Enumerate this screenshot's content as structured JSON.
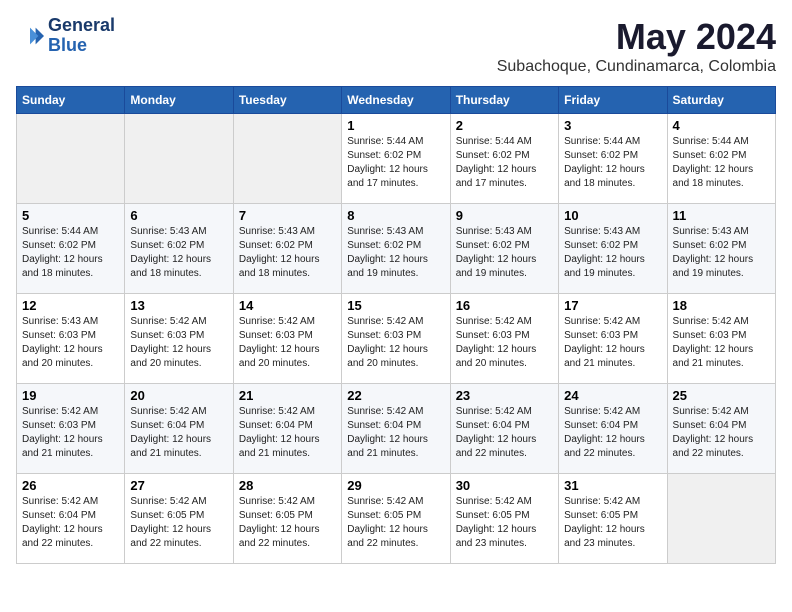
{
  "logo": {
    "line1": "General",
    "line2": "Blue"
  },
  "title": "May 2024",
  "subtitle": "Subachoque, Cundinamarca, Colombia",
  "days_of_week": [
    "Sunday",
    "Monday",
    "Tuesday",
    "Wednesday",
    "Thursday",
    "Friday",
    "Saturday"
  ],
  "weeks": [
    [
      {
        "day": "",
        "info": ""
      },
      {
        "day": "",
        "info": ""
      },
      {
        "day": "",
        "info": ""
      },
      {
        "day": "1",
        "info": "Sunrise: 5:44 AM\nSunset: 6:02 PM\nDaylight: 12 hours\nand 17 minutes."
      },
      {
        "day": "2",
        "info": "Sunrise: 5:44 AM\nSunset: 6:02 PM\nDaylight: 12 hours\nand 17 minutes."
      },
      {
        "day": "3",
        "info": "Sunrise: 5:44 AM\nSunset: 6:02 PM\nDaylight: 12 hours\nand 18 minutes."
      },
      {
        "day": "4",
        "info": "Sunrise: 5:44 AM\nSunset: 6:02 PM\nDaylight: 12 hours\nand 18 minutes."
      }
    ],
    [
      {
        "day": "5",
        "info": "Sunrise: 5:44 AM\nSunset: 6:02 PM\nDaylight: 12 hours\nand 18 minutes."
      },
      {
        "day": "6",
        "info": "Sunrise: 5:43 AM\nSunset: 6:02 PM\nDaylight: 12 hours\nand 18 minutes."
      },
      {
        "day": "7",
        "info": "Sunrise: 5:43 AM\nSunset: 6:02 PM\nDaylight: 12 hours\nand 18 minutes."
      },
      {
        "day": "8",
        "info": "Sunrise: 5:43 AM\nSunset: 6:02 PM\nDaylight: 12 hours\nand 19 minutes."
      },
      {
        "day": "9",
        "info": "Sunrise: 5:43 AM\nSunset: 6:02 PM\nDaylight: 12 hours\nand 19 minutes."
      },
      {
        "day": "10",
        "info": "Sunrise: 5:43 AM\nSunset: 6:02 PM\nDaylight: 12 hours\nand 19 minutes."
      },
      {
        "day": "11",
        "info": "Sunrise: 5:43 AM\nSunset: 6:02 PM\nDaylight: 12 hours\nand 19 minutes."
      }
    ],
    [
      {
        "day": "12",
        "info": "Sunrise: 5:43 AM\nSunset: 6:03 PM\nDaylight: 12 hours\nand 20 minutes."
      },
      {
        "day": "13",
        "info": "Sunrise: 5:42 AM\nSunset: 6:03 PM\nDaylight: 12 hours\nand 20 minutes."
      },
      {
        "day": "14",
        "info": "Sunrise: 5:42 AM\nSunset: 6:03 PM\nDaylight: 12 hours\nand 20 minutes."
      },
      {
        "day": "15",
        "info": "Sunrise: 5:42 AM\nSunset: 6:03 PM\nDaylight: 12 hours\nand 20 minutes."
      },
      {
        "day": "16",
        "info": "Sunrise: 5:42 AM\nSunset: 6:03 PM\nDaylight: 12 hours\nand 20 minutes."
      },
      {
        "day": "17",
        "info": "Sunrise: 5:42 AM\nSunset: 6:03 PM\nDaylight: 12 hours\nand 21 minutes."
      },
      {
        "day": "18",
        "info": "Sunrise: 5:42 AM\nSunset: 6:03 PM\nDaylight: 12 hours\nand 21 minutes."
      }
    ],
    [
      {
        "day": "19",
        "info": "Sunrise: 5:42 AM\nSunset: 6:03 PM\nDaylight: 12 hours\nand 21 minutes."
      },
      {
        "day": "20",
        "info": "Sunrise: 5:42 AM\nSunset: 6:04 PM\nDaylight: 12 hours\nand 21 minutes."
      },
      {
        "day": "21",
        "info": "Sunrise: 5:42 AM\nSunset: 6:04 PM\nDaylight: 12 hours\nand 21 minutes."
      },
      {
        "day": "22",
        "info": "Sunrise: 5:42 AM\nSunset: 6:04 PM\nDaylight: 12 hours\nand 21 minutes."
      },
      {
        "day": "23",
        "info": "Sunrise: 5:42 AM\nSunset: 6:04 PM\nDaylight: 12 hours\nand 22 minutes."
      },
      {
        "day": "24",
        "info": "Sunrise: 5:42 AM\nSunset: 6:04 PM\nDaylight: 12 hours\nand 22 minutes."
      },
      {
        "day": "25",
        "info": "Sunrise: 5:42 AM\nSunset: 6:04 PM\nDaylight: 12 hours\nand 22 minutes."
      }
    ],
    [
      {
        "day": "26",
        "info": "Sunrise: 5:42 AM\nSunset: 6:04 PM\nDaylight: 12 hours\nand 22 minutes."
      },
      {
        "day": "27",
        "info": "Sunrise: 5:42 AM\nSunset: 6:05 PM\nDaylight: 12 hours\nand 22 minutes."
      },
      {
        "day": "28",
        "info": "Sunrise: 5:42 AM\nSunset: 6:05 PM\nDaylight: 12 hours\nand 22 minutes."
      },
      {
        "day": "29",
        "info": "Sunrise: 5:42 AM\nSunset: 6:05 PM\nDaylight: 12 hours\nand 22 minutes."
      },
      {
        "day": "30",
        "info": "Sunrise: 5:42 AM\nSunset: 6:05 PM\nDaylight: 12 hours\nand 23 minutes."
      },
      {
        "day": "31",
        "info": "Sunrise: 5:42 AM\nSunset: 6:05 PM\nDaylight: 12 hours\nand 23 minutes."
      },
      {
        "day": "",
        "info": ""
      }
    ]
  ]
}
